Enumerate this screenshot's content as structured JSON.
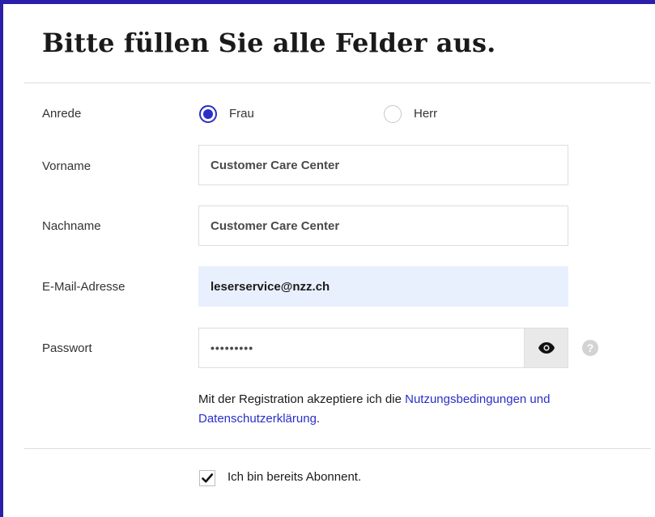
{
  "form": {
    "title": "Bitte füllen Sie alle Felder aus.",
    "salutation": {
      "label": "Anrede",
      "options": [
        {
          "label": "Frau",
          "checked": true
        },
        {
          "label": "Herr",
          "checked": false
        }
      ]
    },
    "firstname": {
      "label": "Vorname",
      "value": "Customer Care Center"
    },
    "lastname": {
      "label": "Nachname",
      "value": "Customer Care Center"
    },
    "email": {
      "label": "E-Mail-Adresse",
      "value": "leserservice@nzz.ch"
    },
    "password": {
      "label": "Passwort",
      "value": "•••••••••",
      "help_symbol": "?"
    },
    "terms": {
      "text": "Mit der Registration akzeptiere ich die ",
      "link": "Nutzungsbedingungen und Datenschutzerklärung",
      "suffix": "."
    },
    "subscriber": {
      "label": "Ich bin bereits Abonnent.",
      "checked": true
    }
  },
  "colors": {
    "accent": "#2a2fc8",
    "frame": "#2a1fa8",
    "autofill": "#e8f0fe"
  }
}
